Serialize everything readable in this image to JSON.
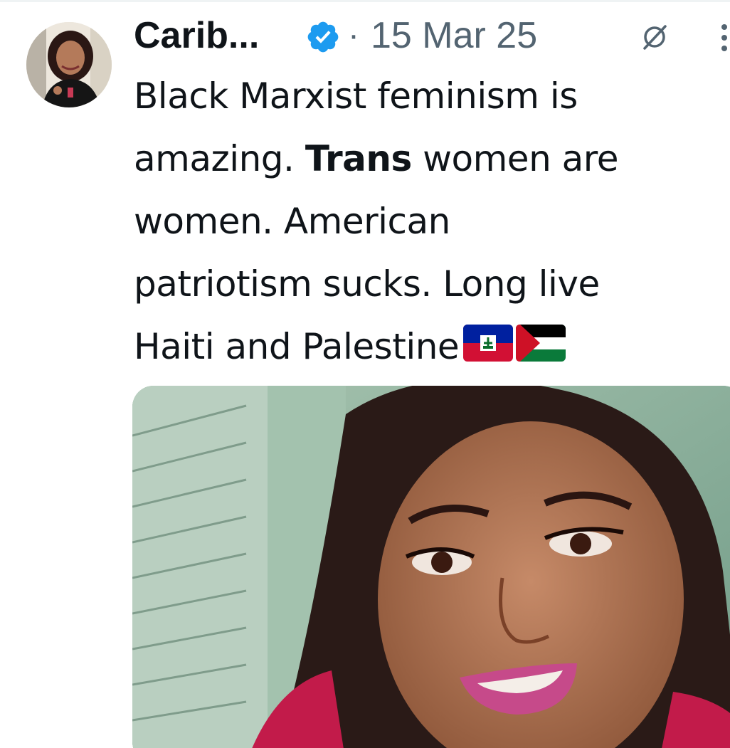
{
  "tweet": {
    "author": {
      "display_name": "Carib...",
      "verified_icon": "verified-badge-icon",
      "avatar": "profile-photo"
    },
    "separator": "·",
    "date": "15 Mar 25",
    "header_icons": [
      "grok-icon",
      "more-icon"
    ],
    "text": {
      "line1": "Black Marxist feminism is",
      "line2_a": "amazing. ",
      "line2_bold": "Trans",
      "line2_b": " women are",
      "line3": "women. American",
      "line4": "patriotism sucks. Long live",
      "line5": "Haiti and Palestine",
      "flags": [
        "haiti-flag-icon",
        "palestine-flag-icon"
      ]
    },
    "media": {
      "type": "photo"
    }
  },
  "colors": {
    "text_primary": "#0f1419",
    "text_secondary": "#536471",
    "verified_blue": "#1d9bf0"
  }
}
